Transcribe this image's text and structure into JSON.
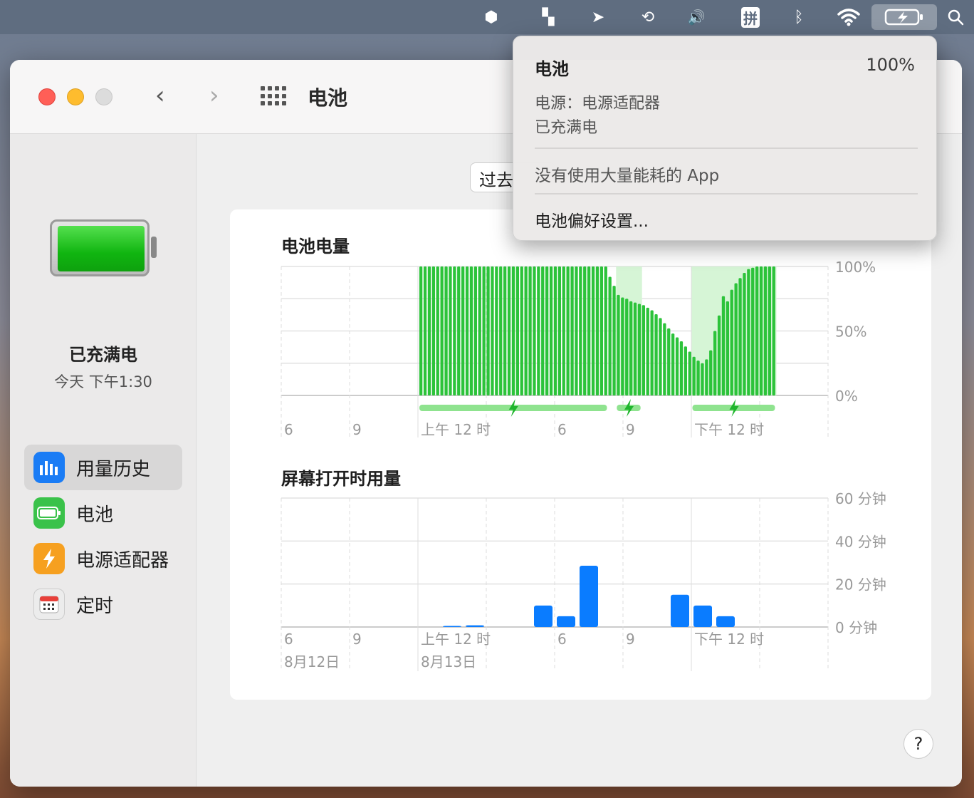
{
  "menubar": {
    "items": [
      {
        "name": "hexagon-icon",
        "glyph": "⬢"
      },
      {
        "name": "app-logo-icon",
        "glyph": "▚"
      },
      {
        "name": "paper-plane-icon",
        "glyph": "➤"
      },
      {
        "name": "sync-icon",
        "glyph": "⟲"
      },
      {
        "name": "volume-icon",
        "glyph": "🔊"
      },
      {
        "name": "input-method-icon",
        "glyph": "拼"
      },
      {
        "name": "bluetooth-icon",
        "glyph": "ᛒ"
      },
      {
        "name": "wifi-icon",
        "glyph": "◠"
      },
      {
        "name": "battery-charging-icon",
        "glyph": "▭"
      },
      {
        "name": "search-icon",
        "glyph": "⌕"
      }
    ]
  },
  "window": {
    "title": "电池",
    "range_label": "过去",
    "help_label": "?"
  },
  "sidebar": {
    "status": "已充满电",
    "time": "今天 下午1:30",
    "items": [
      {
        "label": "用量历史",
        "icon": "bar-chart-icon",
        "color": "#1a7cf5"
      },
      {
        "label": "电池",
        "icon": "battery-icon",
        "color": "#3ac24a"
      },
      {
        "label": "电源适配器",
        "icon": "bolt-icon",
        "color": "#f6a020"
      },
      {
        "label": "定时",
        "icon": "calendar-icon",
        "color": "#e9e9e9"
      }
    ]
  },
  "popup": {
    "title": "电池",
    "percent": "100%",
    "source": "电源：电源适配器",
    "state": "已充满电",
    "apps": "没有使用大量能耗的 App",
    "prefs": "电池偏好设置..."
  },
  "chart_data": [
    {
      "type": "bar",
      "title": "电池电量",
      "y_tick_labels": [
        "100%",
        "50%",
        "0%"
      ],
      "x_tick_labels": [
        "6",
        "9",
        "上午 12 时",
        "6",
        "9",
        "下午 12 时"
      ],
      "ylim": [
        0,
        100
      ],
      "values": [
        100,
        100,
        100,
        100,
        100,
        100,
        100,
        100,
        100,
        100,
        100,
        100,
        100,
        100,
        100,
        100,
        100,
        100,
        100,
        100,
        100,
        100,
        100,
        100,
        100,
        100,
        100,
        100,
        100,
        100,
        100,
        100,
        100,
        100,
        100,
        100,
        100,
        100,
        100,
        100,
        100,
        100,
        100,
        100,
        100,
        92,
        85,
        78,
        76,
        75,
        73,
        72,
        71,
        70,
        68,
        66,
        63,
        60,
        56,
        52,
        48,
        45,
        42,
        38,
        34,
        30,
        27,
        25,
        28,
        35,
        50,
        62,
        77,
        73,
        82,
        87,
        91,
        95,
        98,
        99,
        100,
        100,
        100,
        100,
        100
      ],
      "start_slot": 17,
      "charging_ranges": [
        [
          0,
          45
        ],
        [
          47,
          53
        ],
        [
          65,
          85
        ]
      ],
      "highlight_ranges": [
        [
          47,
          53
        ],
        [
          65,
          85
        ]
      ]
    },
    {
      "type": "bar",
      "title": "屏幕打开时用量",
      "y_tick_labels": [
        "60 分钟",
        "40 分钟",
        "20 分钟",
        "0 分钟"
      ],
      "x_tick_labels": [
        "6",
        "9",
        "上午 12 时",
        "6",
        "9",
        "下午 12 时"
      ],
      "date_labels": [
        "8月12日",
        "8月13日"
      ],
      "ylim": [
        0,
        60
      ],
      "unit": "分钟",
      "bars": [
        {
          "slot": 7,
          "value": 0.5
        },
        {
          "slot": 8,
          "value": 0.8
        },
        {
          "slot": 11,
          "value": 10
        },
        {
          "slot": 12,
          "value": 5
        },
        {
          "slot": 13,
          "value": 28.5
        },
        {
          "slot": 17,
          "value": 15
        },
        {
          "slot": 18,
          "value": 10
        },
        {
          "slot": 19,
          "value": 5
        }
      ],
      "slots": 24,
      "color": "#0a7cff"
    }
  ]
}
